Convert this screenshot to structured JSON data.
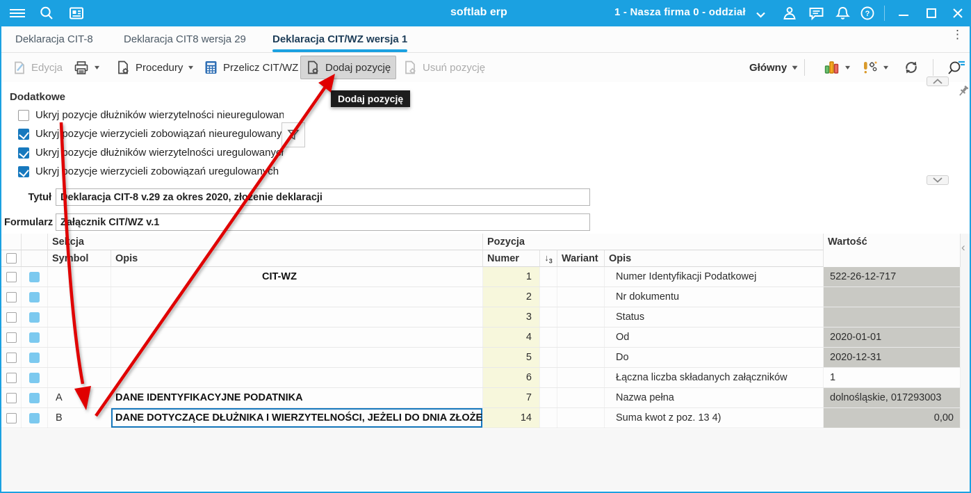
{
  "titlebar": {
    "app_title": "softlab erp",
    "company": "1 - Nasza firma 0 - oddział"
  },
  "tabbar": {
    "tabs": [
      {
        "label": "Deklaracja CIT-8",
        "active": false
      },
      {
        "label": "Deklaracja CIT8 wersja 29",
        "active": false
      },
      {
        "label": "Deklaracja CIT/WZ wersja 1",
        "active": true
      }
    ],
    "overflow_menu": "⋮"
  },
  "toolbar": {
    "edit": "Edycja",
    "procedures": "Procedury",
    "recalc": "Przelicz CIT/WZ",
    "add": "Dodaj pozycję",
    "remove": "Usuń pozycję",
    "view": "Główny"
  },
  "tooltip": {
    "text": "Dodaj pozycję"
  },
  "additional": {
    "title": "Dodatkowe",
    "checkboxes": [
      {
        "label": "Ukryj pozycje dłużników wierzytelności nieuregulowan",
        "checked": false
      },
      {
        "label": "Ukryj pozycje wierzycieli zobowiązań nieuregulowanyc",
        "checked": true
      },
      {
        "label": "Ukryj pozycje dłużników wierzytelności uregulowanych",
        "checked": true
      },
      {
        "label": "Ukryj pozycje wierzycieli zobowiązań uregulowanych",
        "checked": true
      }
    ]
  },
  "form": {
    "title_label": "Tytuł",
    "title_value": "Deklaracja CIT-8 v.29 za okres 2020, złożenie deklaracji",
    "form_label": "Formularz",
    "form_value": "Załącznik CIT/WZ v.1"
  },
  "table": {
    "group_headers": {
      "sekcja": "Sekcja",
      "pozycja": "Pozycja",
      "wartosc": "Wartość"
    },
    "columns": {
      "symbol": "Symbol",
      "opis_sekcja": "Opis",
      "numer": "Numer",
      "wariant": "Wariant",
      "opis_pozycja": "Opis"
    },
    "sort": {
      "glyph": "↓",
      "level": "3"
    },
    "rows": [
      {
        "symbol": "",
        "sekcja_opis": "CIT-WZ",
        "indent": true,
        "numer": "1",
        "wariant": "",
        "opis": "Numer Identyfikacji Podatkowej",
        "wartosc": "522-26-12-717",
        "filled": true,
        "align": "left",
        "selected": false
      },
      {
        "symbol": "",
        "sekcja_opis": "",
        "indent": false,
        "numer": "2",
        "wariant": "",
        "opis": "Nr dokumentu",
        "wartosc": "",
        "filled": true,
        "align": "left",
        "selected": false
      },
      {
        "symbol": "",
        "sekcja_opis": "",
        "indent": false,
        "numer": "3",
        "wariant": "",
        "opis": "Status",
        "wartosc": "",
        "filled": true,
        "align": "left",
        "selected": false
      },
      {
        "symbol": "",
        "sekcja_opis": "",
        "indent": false,
        "numer": "4",
        "wariant": "",
        "opis": "Od",
        "wartosc": "2020-01-01",
        "filled": true,
        "align": "left",
        "selected": false
      },
      {
        "symbol": "",
        "sekcja_opis": "",
        "indent": false,
        "numer": "5",
        "wariant": "",
        "opis": "Do",
        "wartosc": "2020-12-31",
        "filled": true,
        "align": "left",
        "selected": false
      },
      {
        "symbol": "",
        "sekcja_opis": "",
        "indent": false,
        "numer": "6",
        "wariant": "",
        "opis": "Łączna liczba składanych załączników",
        "wartosc": "1",
        "filled": false,
        "align": "left",
        "selected": false
      },
      {
        "symbol": "A",
        "sekcja_opis": "DANE IDENTYFIKACYJNE PODATNIKA",
        "indent": false,
        "numer": "7",
        "wariant": "",
        "opis": "Nazwa pełna",
        "wartosc": "dolnośląskie, 017293003",
        "filled": true,
        "align": "left",
        "selected": false
      },
      {
        "symbol": "B",
        "sekcja_opis": "DANE DOTYCZĄCE DŁUŻNIKA I WIERZYTELNOŚCI, JEŻELI DO DNIA ZŁOŻEN",
        "indent": false,
        "numer": "14",
        "wariant": "",
        "opis": "Suma kwot z poz. 13 4)",
        "wartosc": "0,00",
        "filled": true,
        "align": "right",
        "selected": true
      }
    ]
  },
  "side_controls": {
    "prev_column": "‹"
  },
  "colors": {
    "topbar": "#1BA1E1",
    "accent": "#1779BE",
    "value_cell": "#C9C9C4",
    "numer_cell": "#F7F7DC",
    "arrow": "#E00000",
    "indicator": "#7CC9EF"
  }
}
